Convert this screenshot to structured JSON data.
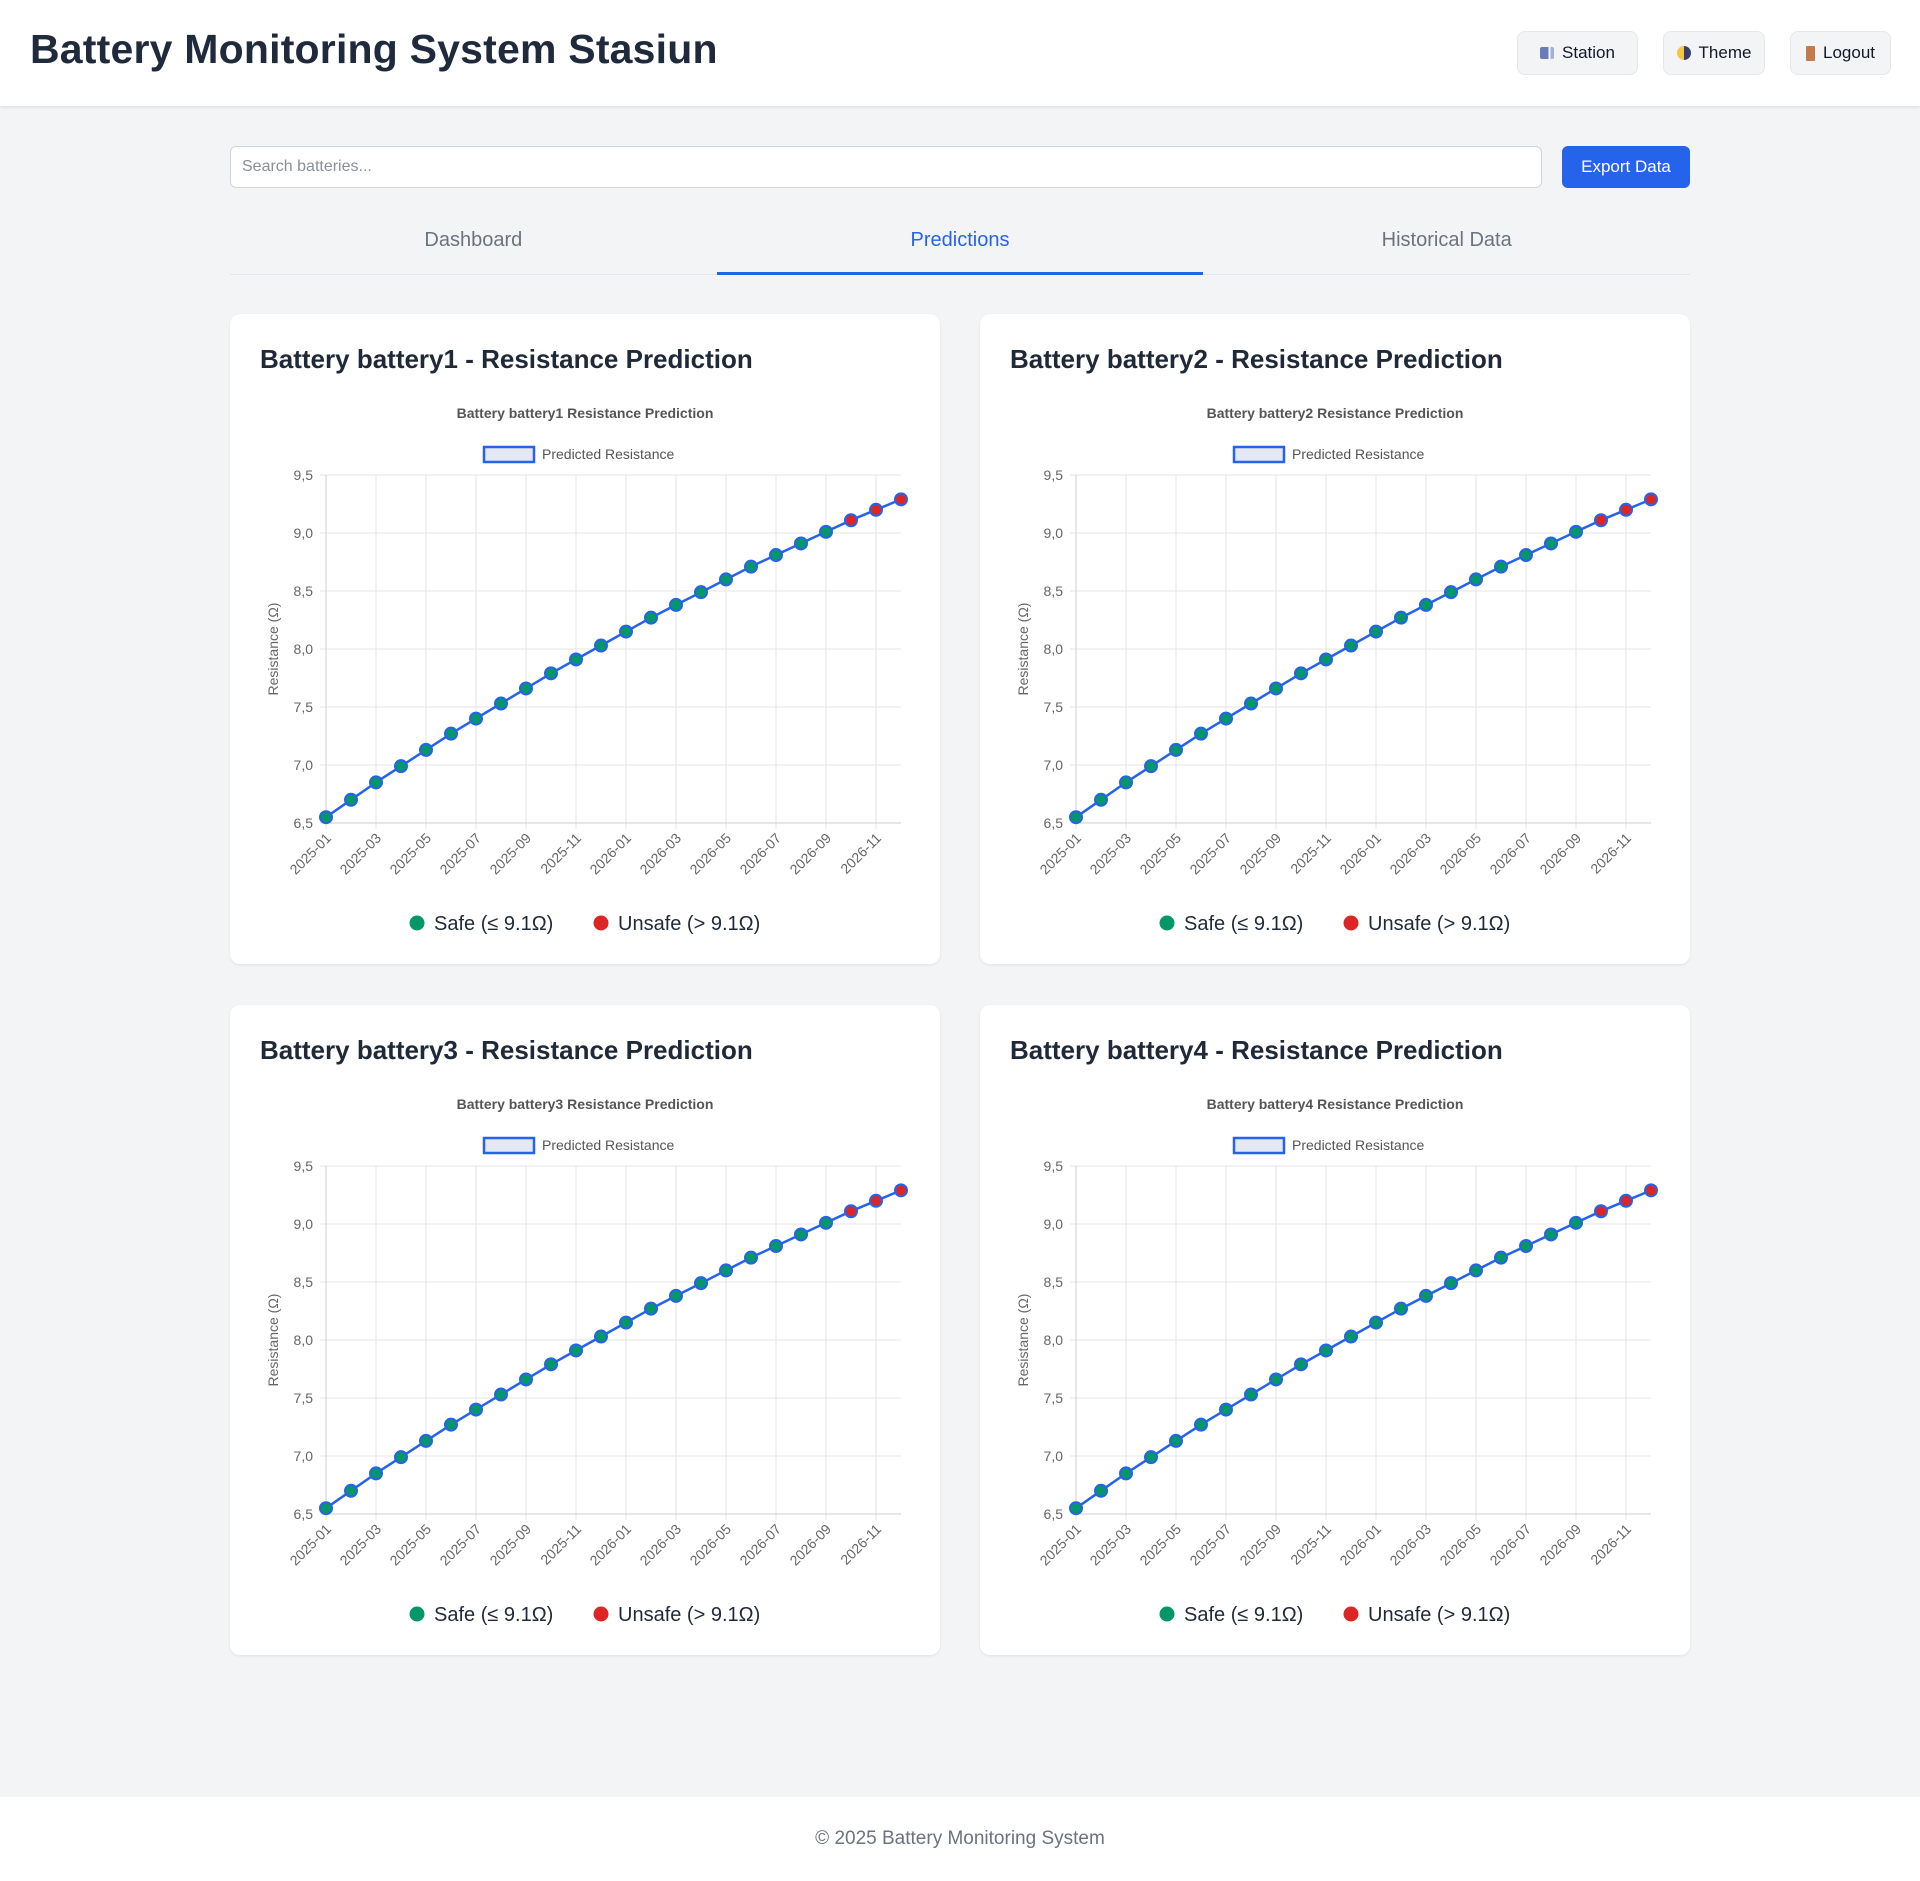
{
  "header": {
    "title": "Battery Monitoring System Stasiun",
    "buttons": {
      "station": "Station",
      "theme": "Theme",
      "logout": "Logout"
    }
  },
  "search": {
    "placeholder": "Search batteries...",
    "value": ""
  },
  "export_label": "Export Data",
  "tabs": [
    {
      "label": "Dashboard",
      "active": false
    },
    {
      "label": "Predictions",
      "active": true
    },
    {
      "label": "Historical Data",
      "active": false
    }
  ],
  "colors": {
    "line": "#2563eb",
    "safe": "#059669",
    "unsafe": "#dc2626",
    "accent": "#2563eb"
  },
  "cards": [
    {
      "title": "Battery battery1 - Resistance Prediction"
    },
    {
      "title": "Battery battery2 - Resistance Prediction"
    },
    {
      "title": "Battery battery3 - Resistance Prediction"
    },
    {
      "title": "Battery battery4 - Resistance Prediction"
    }
  ],
  "status_legend": {
    "safe": "Safe (≤ 9.1Ω)",
    "unsafe": "Unsafe (> 9.1Ω)"
  },
  "chart_data": [
    {
      "type": "line",
      "title": "Battery battery1 Resistance Prediction",
      "ylabel": "Resistance (Ω)",
      "xlabel": "",
      "x": [
        "2025-01",
        "2025-02",
        "2025-03",
        "2025-04",
        "2025-05",
        "2025-06",
        "2025-07",
        "2025-08",
        "2025-09",
        "2025-10",
        "2025-11",
        "2025-12",
        "2026-01",
        "2026-02",
        "2026-03",
        "2026-04",
        "2026-05",
        "2026-06",
        "2026-07",
        "2026-08",
        "2026-09",
        "2026-10",
        "2026-11",
        "2026-12"
      ],
      "x_tick_labels": [
        "2025-01",
        "2025-03",
        "2025-05",
        "2025-07",
        "2025-09",
        "2025-11",
        "2026-01",
        "2026-03",
        "2026-05",
        "2026-07",
        "2026-09",
        "2026-11"
      ],
      "y_ticks": [
        "9,5",
        "9,0",
        "8,5",
        "8,0",
        "7,5",
        "7,0",
        "6,5"
      ],
      "ylim": [
        6.5,
        9.5
      ],
      "series": [
        {
          "name": "Predicted Resistance",
          "values": [
            6.55,
            6.7,
            6.85,
            6.99,
            7.13,
            7.27,
            7.4,
            7.53,
            7.66,
            7.79,
            7.91,
            8.03,
            8.15,
            8.27,
            8.38,
            8.49,
            8.6,
            8.71,
            8.81,
            8.91,
            9.01,
            9.11,
            9.2,
            9.29
          ]
        }
      ],
      "threshold": 9.1,
      "grid": true,
      "legend": "top"
    },
    {
      "type": "line",
      "title": "Battery battery2 Resistance Prediction",
      "ylabel": "Resistance (Ω)",
      "xlabel": "",
      "x": [
        "2025-01",
        "2025-02",
        "2025-03",
        "2025-04",
        "2025-05",
        "2025-06",
        "2025-07",
        "2025-08",
        "2025-09",
        "2025-10",
        "2025-11",
        "2025-12",
        "2026-01",
        "2026-02",
        "2026-03",
        "2026-04",
        "2026-05",
        "2026-06",
        "2026-07",
        "2026-08",
        "2026-09",
        "2026-10",
        "2026-11",
        "2026-12"
      ],
      "x_tick_labels": [
        "2025-01",
        "2025-03",
        "2025-05",
        "2025-07",
        "2025-09",
        "2025-11",
        "2026-01",
        "2026-03",
        "2026-05",
        "2026-07",
        "2026-09",
        "2026-11"
      ],
      "y_ticks": [
        "9,5",
        "9,0",
        "8,5",
        "8,0",
        "7,5",
        "7,0",
        "6,5"
      ],
      "ylim": [
        6.5,
        9.5
      ],
      "series": [
        {
          "name": "Predicted Resistance",
          "values": [
            6.55,
            6.7,
            6.85,
            6.99,
            7.13,
            7.27,
            7.4,
            7.53,
            7.66,
            7.79,
            7.91,
            8.03,
            8.15,
            8.27,
            8.38,
            8.49,
            8.6,
            8.71,
            8.81,
            8.91,
            9.01,
            9.11,
            9.2,
            9.29
          ]
        }
      ],
      "threshold": 9.1,
      "grid": true,
      "legend": "top"
    },
    {
      "type": "line",
      "title": "Battery battery3 Resistance Prediction",
      "ylabel": "Resistance (Ω)",
      "xlabel": "",
      "x": [
        "2025-01",
        "2025-02",
        "2025-03",
        "2025-04",
        "2025-05",
        "2025-06",
        "2025-07",
        "2025-08",
        "2025-09",
        "2025-10",
        "2025-11",
        "2025-12",
        "2026-01",
        "2026-02",
        "2026-03",
        "2026-04",
        "2026-05",
        "2026-06",
        "2026-07",
        "2026-08",
        "2026-09",
        "2026-10",
        "2026-11",
        "2026-12"
      ],
      "x_tick_labels": [
        "2025-01",
        "2025-03",
        "2025-05",
        "2025-07",
        "2025-09",
        "2025-11",
        "2026-01",
        "2026-03",
        "2026-05",
        "2026-07",
        "2026-09",
        "2026-11"
      ],
      "y_ticks": [
        "9,5",
        "9,0",
        "8,5",
        "8,0",
        "7,5",
        "7,0",
        "6,5"
      ],
      "ylim": [
        6.5,
        9.5
      ],
      "series": [
        {
          "name": "Predicted Resistance",
          "values": [
            6.55,
            6.7,
            6.85,
            6.99,
            7.13,
            7.27,
            7.4,
            7.53,
            7.66,
            7.79,
            7.91,
            8.03,
            8.15,
            8.27,
            8.38,
            8.49,
            8.6,
            8.71,
            8.81,
            8.91,
            9.01,
            9.11,
            9.2,
            9.29
          ]
        }
      ],
      "threshold": 9.1,
      "grid": true,
      "legend": "top"
    },
    {
      "type": "line",
      "title": "Battery battery4 Resistance Prediction",
      "ylabel": "Resistance (Ω)",
      "xlabel": "",
      "x": [
        "2025-01",
        "2025-02",
        "2025-03",
        "2025-04",
        "2025-05",
        "2025-06",
        "2025-07",
        "2025-08",
        "2025-09",
        "2025-10",
        "2025-11",
        "2025-12",
        "2026-01",
        "2026-02",
        "2026-03",
        "2026-04",
        "2026-05",
        "2026-06",
        "2026-07",
        "2026-08",
        "2026-09",
        "2026-10",
        "2026-11",
        "2026-12"
      ],
      "x_tick_labels": [
        "2025-01",
        "2025-03",
        "2025-05",
        "2025-07",
        "2025-09",
        "2025-11",
        "2026-01",
        "2026-03",
        "2026-05",
        "2026-07",
        "2026-09",
        "2026-11"
      ],
      "y_ticks": [
        "9,5",
        "9,0",
        "8,5",
        "8,0",
        "7,5",
        "7,0",
        "6,5"
      ],
      "ylim": [
        6.5,
        9.5
      ],
      "series": [
        {
          "name": "Predicted Resistance",
          "values": [
            6.55,
            6.7,
            6.85,
            6.99,
            7.13,
            7.27,
            7.4,
            7.53,
            7.66,
            7.79,
            7.91,
            8.03,
            8.15,
            8.27,
            8.38,
            8.49,
            8.6,
            8.71,
            8.81,
            8.91,
            9.01,
            9.11,
            9.2,
            9.29
          ]
        }
      ],
      "threshold": 9.1,
      "grid": true,
      "legend": "top"
    }
  ],
  "footer": {
    "text": "© 2025 Battery Monitoring System"
  }
}
